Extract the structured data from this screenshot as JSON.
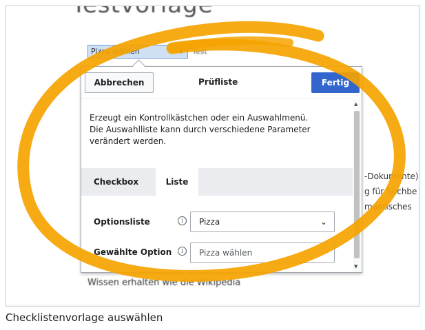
{
  "page": {
    "heading": "Testvorlage",
    "caption": "Checklistenvorlage auswählen"
  },
  "template_preview": {
    "select_value": "Pizza wählen",
    "label": "Test"
  },
  "dialog": {
    "cancel_label": "Abbrechen",
    "title": "Prüfliste",
    "done_label": "Fertig",
    "description": "Erzeugt ein Kontrollkästchen oder ein Auswahlmenü. Die Auswahlliste kann durch verschiedene Parameter verändert werden.",
    "tabs": [
      {
        "label": "Checkbox",
        "active": false
      },
      {
        "label": "Liste",
        "active": true
      }
    ],
    "fields": {
      "options_list": {
        "label": "Optionsliste",
        "value": "Pizza"
      },
      "selected_option": {
        "label": "Gewählte Option",
        "placeholder": "Pizza wählen"
      }
    }
  },
  "background": {
    "right_line_1": "-Dokumente) i",
    "right_line_2": "g für Suchbe",
    "right_line_3": "mantisches",
    "bottom_line": "Wissen erhalten wie die Wikipedia"
  },
  "colors": {
    "primary_button": "#3366cc",
    "marker_stroke": "#f5a300"
  },
  "icons": [
    "info-icon",
    "chevron-down-icon",
    "scroll-up-icon",
    "scroll-down-icon"
  ]
}
